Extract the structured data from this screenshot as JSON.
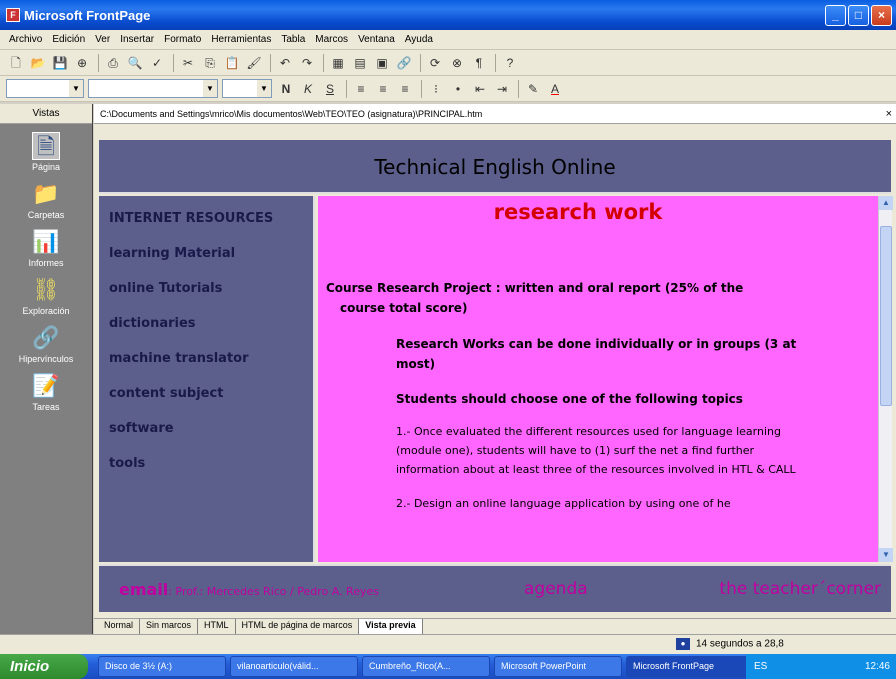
{
  "window": {
    "title": "Microsoft FrontPage"
  },
  "menu": [
    "Archivo",
    "Edición",
    "Ver",
    "Insertar",
    "Formato",
    "Herramientas",
    "Tabla",
    "Marcos",
    "Ventana",
    "Ayuda"
  ],
  "views": {
    "header": "Vistas",
    "items": [
      "Página",
      "Carpetas",
      "Informes",
      "Exploración",
      "Hipervínculos",
      "Tareas"
    ]
  },
  "path": "C:\\Documents and Settings\\mrico\\Mis documentos\\Web\\TEO\\TEO (asignatura)\\PRINCIPAL.htm",
  "page": {
    "banner": "Technical English Online",
    "nav": [
      "INTERNET RESOURCES",
      "learning Material",
      "online Tutorials",
      "dictionaries",
      "machine translator",
      "content subject",
      "software",
      "tools"
    ],
    "heading": "research work",
    "p1_a": "Course Research Project : written and oral report  (25% of the",
    "p1_b": "course total score)",
    "p2": "Research Works can be done individually or in groups (3 at most)",
    "p3": "Students should choose one of the following topics",
    "p4": "1.- Once evaluated the different resources used for language learning (module one), students will have to (1) surf the net a find further information about at least three of the resources involved in HTL & CALL",
    "p5": "2.- Design an online language application by using one of he",
    "footer": {
      "email": "email",
      "email_names": ": Prof.: Mercedes Rico / Pedro A. Reyes",
      "agenda": "agenda",
      "teacher": "the teacher´corner"
    }
  },
  "tabs": [
    "Normal",
    "Sin marcos",
    "HTML",
    "HTML de página de marcos",
    "Vista previa"
  ],
  "status": {
    "timing": "14 segundos a 28,8"
  },
  "taskbar": {
    "start": "Inicio",
    "tasks": [
      "Disco de 3½ (A:)",
      "vilanoarticulo(válid...",
      "Cumbreño_Rico(A...",
      "Microsoft PowerPoint",
      "Microsoft FrontPage"
    ],
    "lang": "ES",
    "clock": "12:46"
  }
}
